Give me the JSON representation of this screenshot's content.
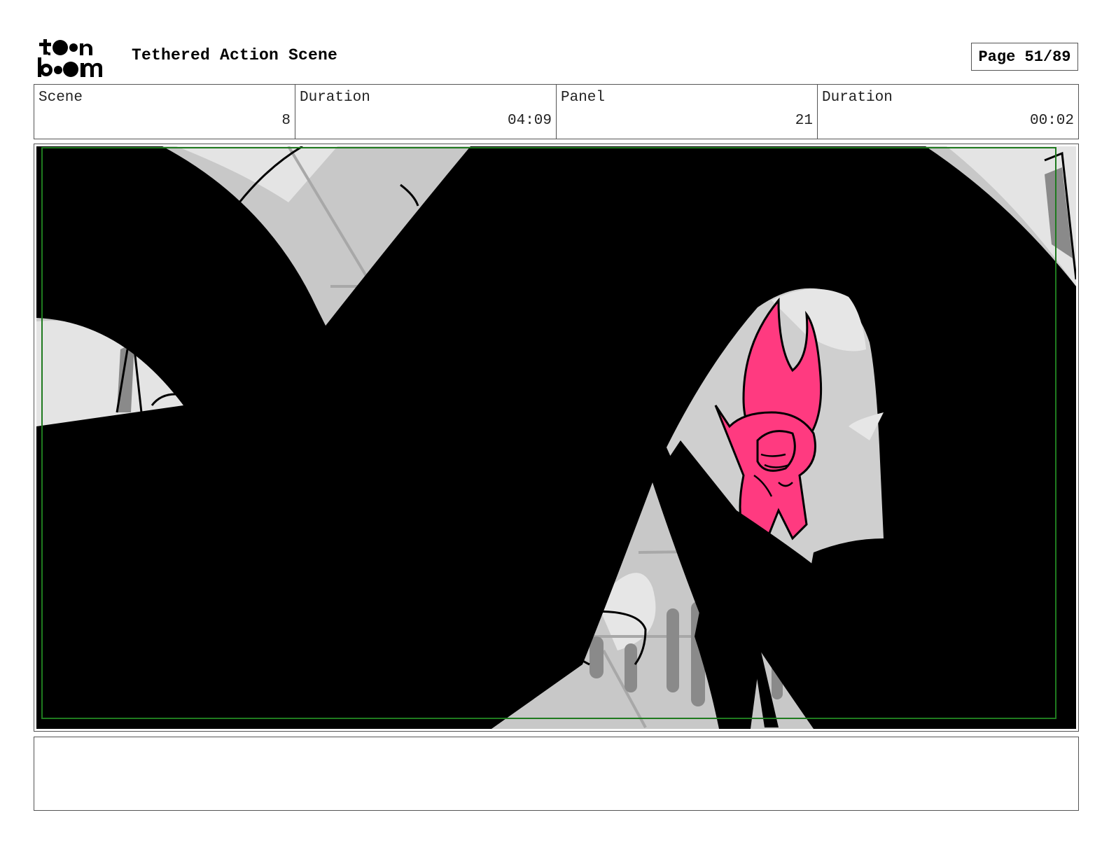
{
  "header": {
    "logo_text": "toon boom",
    "title": "Tethered Action Scene",
    "page_label": "Page 51/89"
  },
  "info": {
    "scene_label": "Scene",
    "scene_value": "8",
    "scene_duration_label": "Duration",
    "scene_duration_value": "04:09",
    "panel_label": "Panel",
    "panel_value": "21",
    "panel_duration_label": "Duration",
    "panel_duration_value": "00:02"
  },
  "panel": {
    "colors": {
      "silhouette": "#000000",
      "background": "#c8c8c8",
      "light_cloud": "#e6e6e6",
      "character": "#ff3a80",
      "safe_area": "#1f7a1f"
    }
  },
  "notes": {
    "text": ""
  }
}
